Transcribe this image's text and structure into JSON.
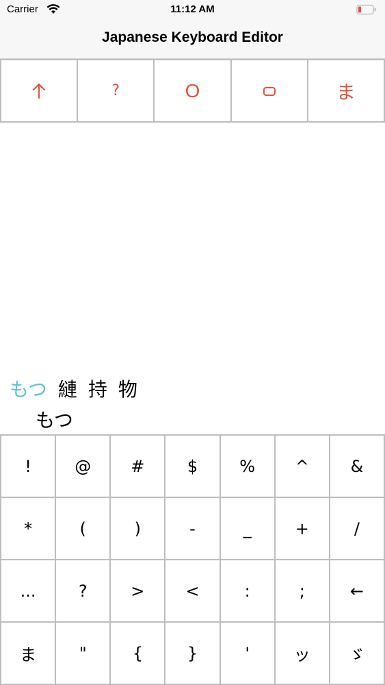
{
  "status_bar": {
    "carrier": "Carrier",
    "time": "11:12 AM",
    "wifi_icon": "wifi-icon",
    "battery_icon": "battery-low-icon",
    "battery_color": "#e5503d"
  },
  "nav": {
    "title": "Japanese Keyboard Editor"
  },
  "toolbar": {
    "color": "#e5503d",
    "buttons": [
      {
        "label": "↑",
        "icon": "up-arrow-icon"
      },
      {
        "label": "?",
        "icon": "question-icon"
      },
      {
        "label": "O",
        "icon": "circle-o-icon"
      },
      {
        "label": "▭",
        "icon": "rounded-rectangle-icon"
      },
      {
        "label": "ま",
        "icon": "hiragana-ma"
      }
    ]
  },
  "candidates": {
    "selected_color": "#5bc0de",
    "items": [
      {
        "text": "もつ",
        "selected": true
      },
      {
        "text": "縺",
        "selected": false
      },
      {
        "text": "持",
        "selected": false
      },
      {
        "text": "物",
        "selected": false
      }
    ]
  },
  "reading": "もつ",
  "keyboard": {
    "rows": [
      [
        "!",
        "@",
        "#",
        "$",
        "%",
        "^",
        "&"
      ],
      [
        "*",
        "(",
        ")",
        "-",
        "_",
        "+",
        "/"
      ],
      [
        "...",
        "?",
        ">",
        "<",
        ":",
        ";",
        "←"
      ],
      [
        "ま",
        "\"",
        "{",
        "}",
        "'",
        "ッ",
        "ゞ"
      ]
    ]
  }
}
